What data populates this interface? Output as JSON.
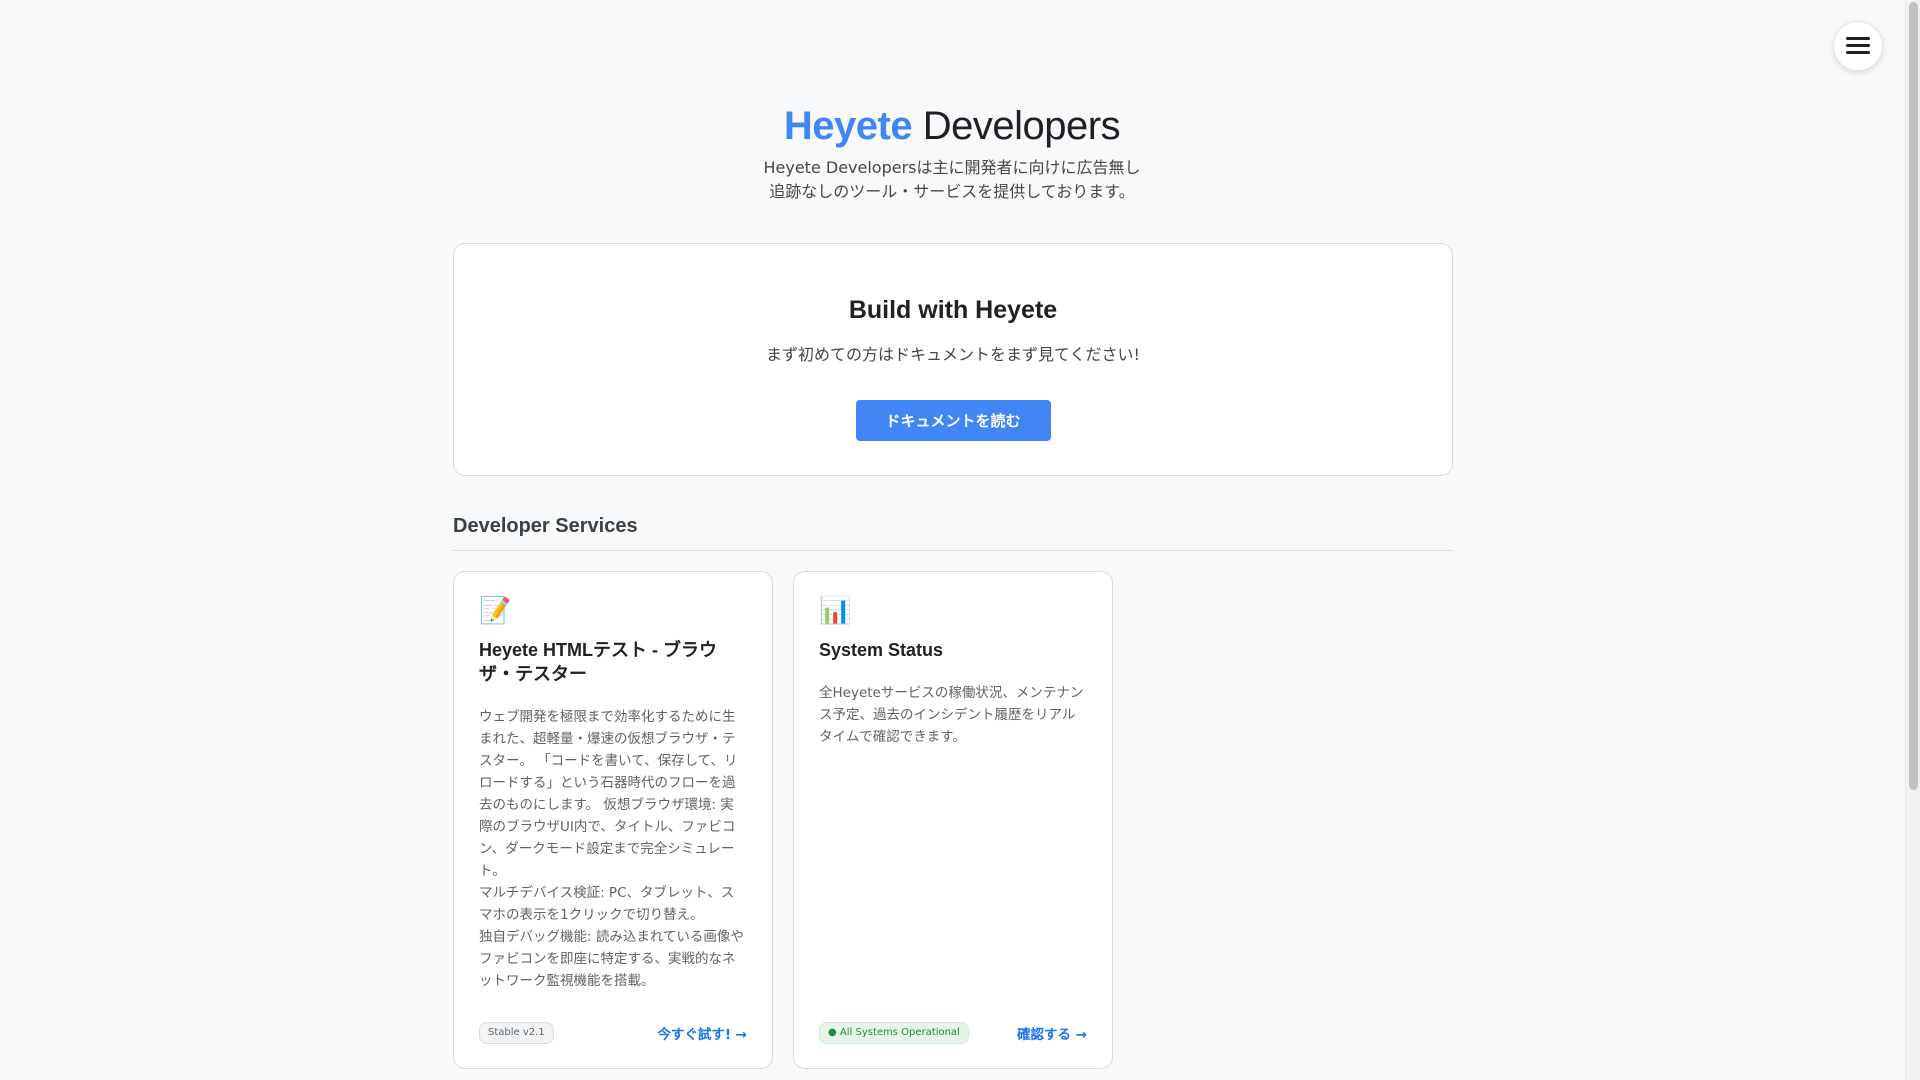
{
  "header": {
    "brand": "Heyete",
    "title_rest": " Developers",
    "subtitle_line1": "Heyete Developersは主に開発者に向けに広告無し",
    "subtitle_line2": "追跡なしのツール・サービスを提供しております。"
  },
  "menu": {
    "icon": "hamburger-menu-icon"
  },
  "build": {
    "title": "Build with Heyete",
    "text": "まず初めての方はドキュメントをまず見てください!",
    "button_label": "ドキュメントを読む"
  },
  "services": {
    "section_title": "Developer Services",
    "items": [
      {
        "icon": "📝",
        "icon_name": "memo-icon",
        "title": "Heyete HTMLテスト - ブラウザ・テスター",
        "desc_paragraphs": [
          "ウェブ開発を極限まで効率化するために生まれた、超軽量・爆速の仮想ブラウザ・テスター。 「コードを書いて、保存して、リロードする」という石器時代のフローを過去のものにします。 仮想ブラウザ環境: 実際のブラウザUI内で、タイトル、ファビコン、ダークモード設定まで完全シミュレート。",
          "マルチデバイス検証: PC、タブレット、スマホの表示を1クリックで切り替え。",
          "独自デバッグ機能: 読み込まれている画像やファビコンを即座に特定する、実戦的なネットワーク監視機能を搭載。"
        ],
        "badge": "Stable v2.1",
        "link_label": "今すぐ試す! →"
      },
      {
        "icon": "📊",
        "icon_name": "bar-chart-icon",
        "title": "System Status",
        "desc_paragraphs": [
          "全Heyeteサービスの稼働状況、メンテナンス予定、過去のインシデント履歴をリアルタイムで確認できます。"
        ],
        "badge": "● All Systems Operational",
        "link_label": "確認する →"
      }
    ]
  },
  "colors": {
    "brand_blue": "#4285f4",
    "link_blue": "#1a73e8",
    "status_green": "#1e8e3e",
    "background": "#f8f9fa"
  }
}
